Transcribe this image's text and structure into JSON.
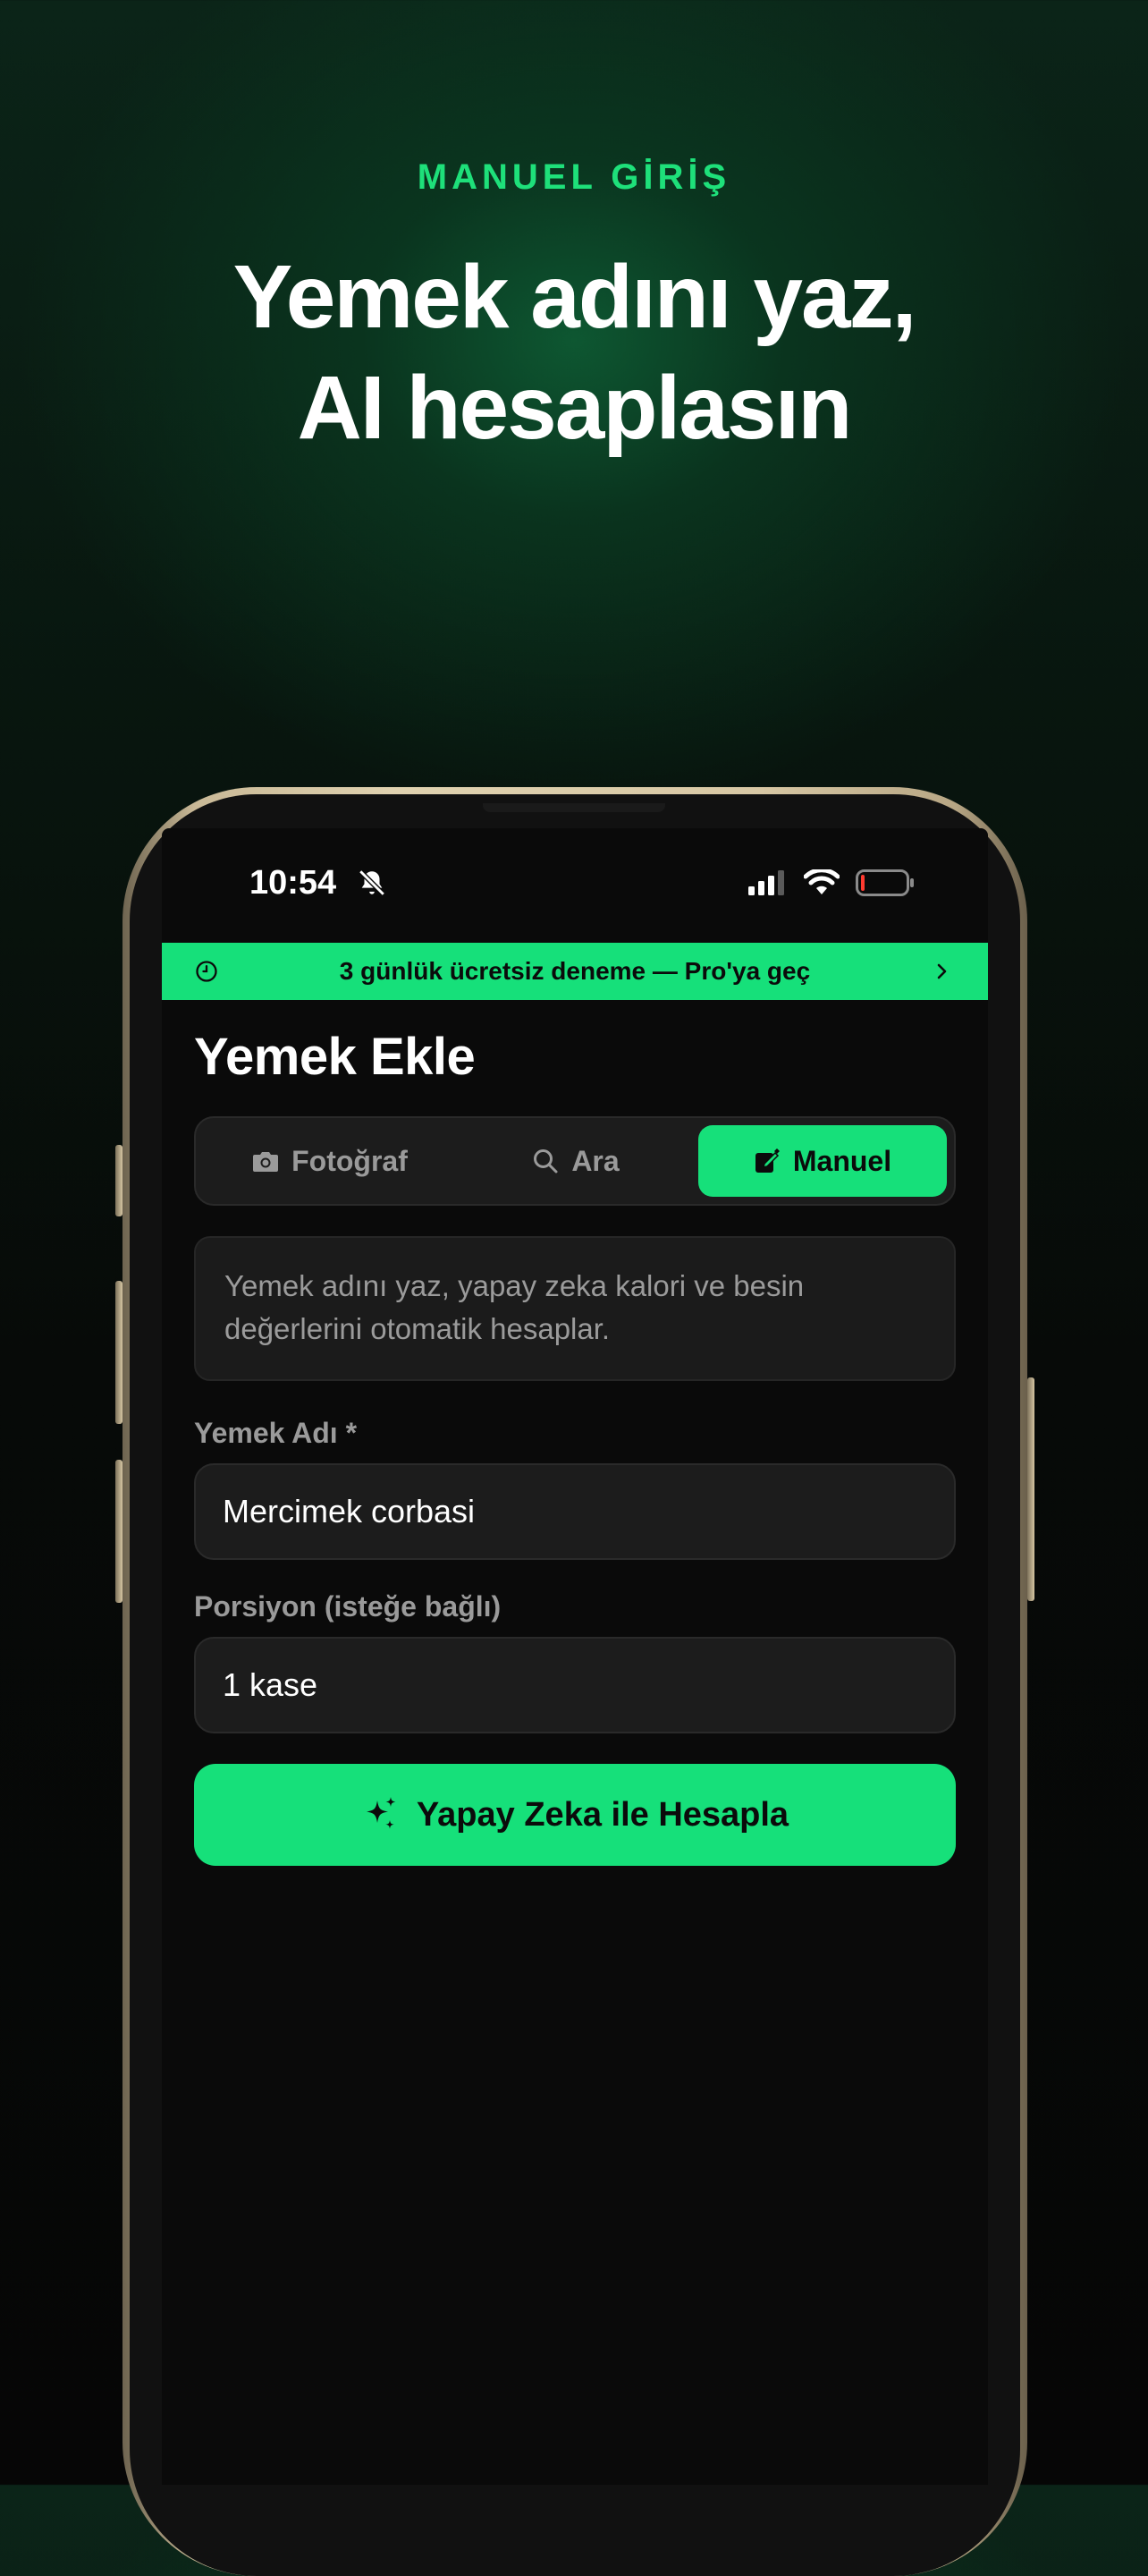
{
  "promo": {
    "eyebrow": "MANUEL GİRİŞ",
    "headline_line1": "Yemek adını yaz,",
    "headline_line2": "AI hesaplasın"
  },
  "status_bar": {
    "time": "10:54",
    "silent_icon": "bell-slash-icon",
    "signal_icon": "cellular-signal-icon",
    "wifi_icon": "wifi-icon",
    "battery_icon": "battery-low-icon"
  },
  "trial_banner": {
    "text": "3 günlük ücretsiz deneme — Pro'ya geç",
    "icon": "clock-icon",
    "chevron": "chevron-right-icon"
  },
  "page": {
    "title": "Yemek Ekle"
  },
  "tabs": [
    {
      "label": "Fotoğraf",
      "icon": "camera-icon",
      "active": false
    },
    {
      "label": "Ara",
      "icon": "search-icon",
      "active": false
    },
    {
      "label": "Manuel",
      "icon": "edit-icon",
      "active": true
    }
  ],
  "info": {
    "text": "Yemek adını yaz, yapay zeka kalori ve besin değerlerini otomatik hesaplar."
  },
  "form": {
    "food_name_label": "Yemek Adı *",
    "food_name_value": "Mercimek corbasi",
    "portion_label": "Porsiyon (isteğe bağlı)",
    "portion_value": "1 kase"
  },
  "actions": {
    "calculate_label": "Yapay Zeka ile Hesapla",
    "calculate_icon": "sparkles-icon"
  },
  "colors": {
    "accent": "#16e07a",
    "background": "#0a0a0a",
    "surface": "#1c1c1c",
    "muted_text": "#9a9a9a"
  }
}
